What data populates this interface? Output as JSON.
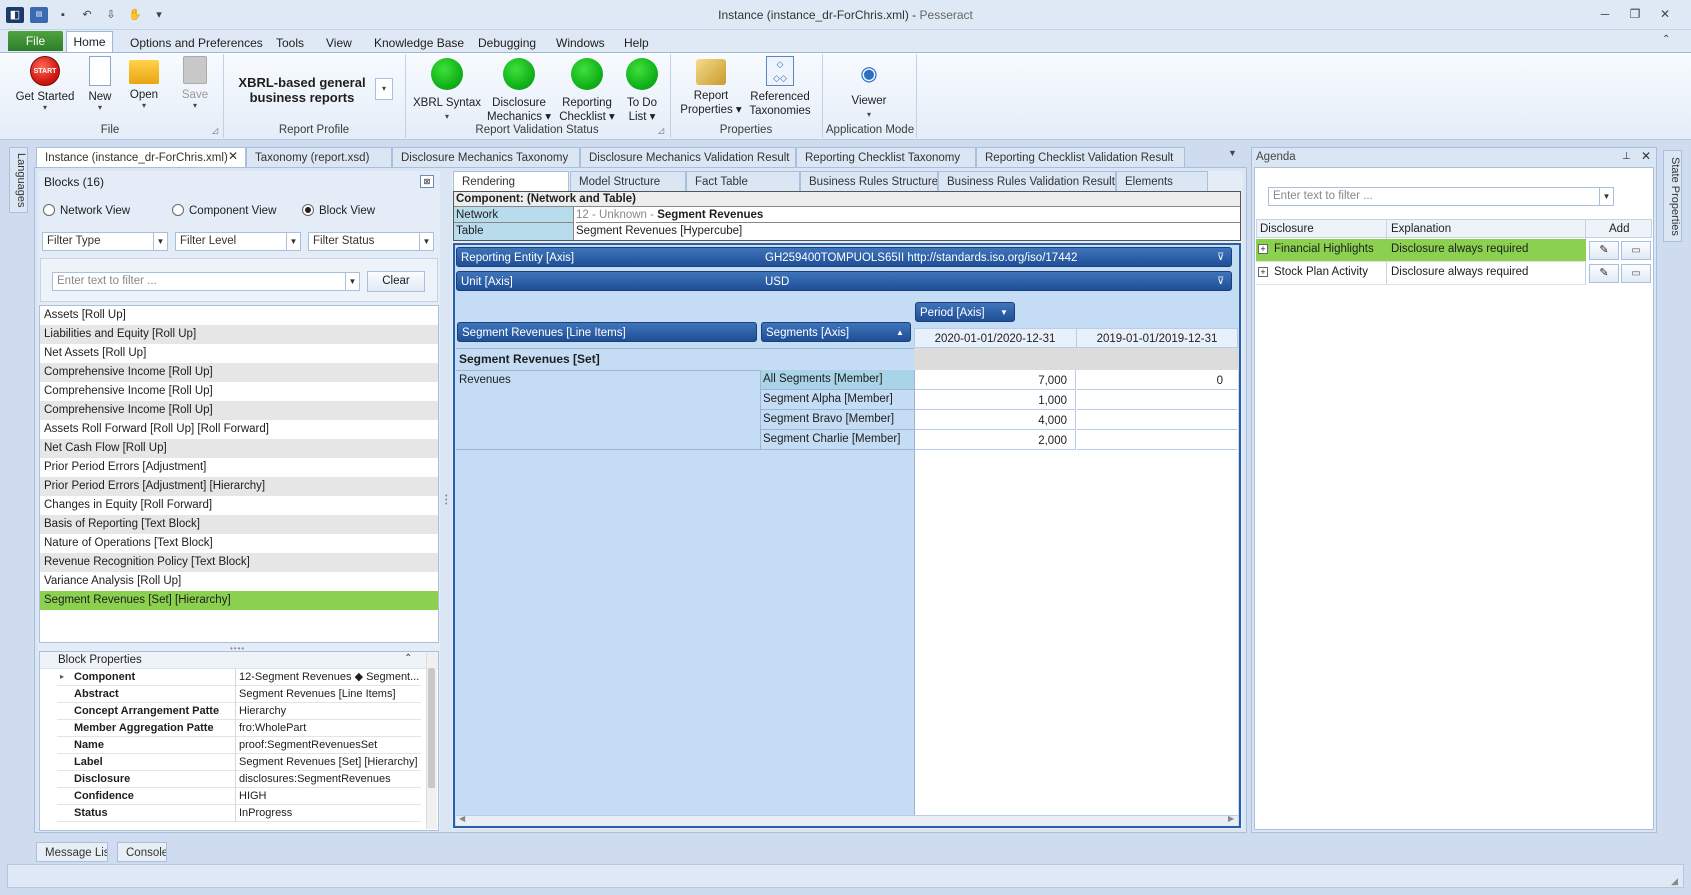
{
  "window": {
    "title": "Instance (instance_dr-ForChris.xml)",
    "app_name": "Pesseract",
    "controls": [
      "minimize",
      "restore",
      "close"
    ]
  },
  "menu": {
    "file": "File",
    "tabs": [
      "Home",
      "Options and Preferences",
      "Tools",
      "View",
      "Knowledge Base",
      "Debugging",
      "Windows",
      "Help"
    ]
  },
  "ribbon": {
    "file_group": {
      "label": "File",
      "buttons": [
        "Get Started",
        "New",
        "Open",
        "Save"
      ],
      "start_text": "START"
    },
    "report_profile": {
      "label": "Report Profile",
      "line1": "XBRL-based general",
      "line2": "business reports"
    },
    "validation": {
      "label": "Report Validation Status",
      "buttons": [
        {
          "l1": "XBRL Syntax",
          "l2": ""
        },
        {
          "l1": "Disclosure",
          "l2": "Mechanics"
        },
        {
          "l1": "Reporting",
          "l2": "Checklist"
        },
        {
          "l1": "To Do",
          "l2": "List"
        }
      ]
    },
    "properties": {
      "label": "Properties",
      "buttons": [
        {
          "l1": "Report",
          "l2": "Properties"
        },
        {
          "l1": "Referenced",
          "l2": "Taxonomies"
        }
      ]
    },
    "mode": {
      "label": "Application Mode",
      "button": "Viewer"
    }
  },
  "left_sidebar": {
    "label": "Languages"
  },
  "right_sidebar": {
    "label": "State Properties"
  },
  "doc_tabs": [
    "Instance (instance_dr-ForChris.xml)",
    "Taxonomy (report.xsd)",
    "Disclosure Mechanics Taxonomy",
    "Disclosure Mechanics Validation Result",
    "Reporting Checklist Taxonomy",
    "Reporting Checklist Validation Result"
  ],
  "blocks": {
    "header": "Blocks (16)",
    "views": [
      "Network View",
      "Component View",
      "Block View"
    ],
    "filters": [
      "Filter Type",
      "Filter Level",
      "Filter Status"
    ],
    "filter_placeholder": "Enter text to filter ...",
    "clear": "Clear",
    "items": [
      "Assets [Roll Up]",
      "Liabilities and Equity [Roll Up]",
      "Net Assets [Roll Up]",
      "Comprehensive Income [Roll Up]",
      "Comprehensive Income [Roll Up]",
      "Comprehensive Income [Roll Up]",
      "Assets Roll Forward [Roll Up] [Roll Forward]",
      "Net Cash Flow [Roll Up]",
      "Prior Period Errors [Adjustment]",
      "Prior Period Errors [Adjustment] [Hierarchy]",
      "Changes in Equity [Roll Forward]",
      "Basis of Reporting [Text Block]",
      "Nature of Operations [Text Block]",
      "Revenue Recognition Policy [Text Block]",
      "Variance Analysis  [Roll Up]",
      "Segment Revenues [Set] [Hierarchy]"
    ]
  },
  "block_properties": {
    "header": "Block Properties",
    "rows": [
      {
        "k": "Component",
        "v": "12-Segment Revenues ◆ Segment..."
      },
      {
        "k": "Abstract",
        "v": "Segment Revenues [Line Items]"
      },
      {
        "k": "Concept Arrangement Patte",
        "v": "Hierarchy"
      },
      {
        "k": "Member Aggregation Patte",
        "v": "fro:WholePart"
      },
      {
        "k": "Name",
        "v": "proof:SegmentRevenuesSet"
      },
      {
        "k": "Label",
        "v": "Segment Revenues [Set] [Hierarchy]"
      },
      {
        "k": "Disclosure",
        "v": "disclosures:SegmentRevenues"
      },
      {
        "k": "Confidence",
        "v": "HIGH"
      },
      {
        "k": "Status",
        "v": "InProgress"
      }
    ]
  },
  "view_tabs": [
    "Rendering",
    "Model Structure",
    "Fact Table",
    "Business Rules Structure",
    "Business Rules Validation Results",
    "Elements"
  ],
  "component": {
    "header": "Component: (Network and Table)",
    "network_label": "Network",
    "network_prefix": "12 - Unknown - ",
    "network_value": "Segment Revenues",
    "table_label": "Table",
    "table_value": "Segment Revenues [Hypercube]"
  },
  "rendering": {
    "entity_axis": "Reporting Entity [Axis]",
    "entity_value": "GH259400TOMPUOLS65II http://standards.iso.org/iso/17442",
    "unit_axis": "Unit [Axis]",
    "unit_value": "USD",
    "period_axis": "Period [Axis]",
    "line_items": "Segment Revenues [Line Items]",
    "segments_axis": "Segments [Axis]",
    "periods": [
      "2020-01-01/2020-12-31",
      "2019-01-01/2019-12-31"
    ],
    "set_label": "Segment Revenues [Set]",
    "concept": "Revenues",
    "members": [
      {
        "name": "All Segments [Member]",
        "v1": "7,000",
        "v2": "0"
      },
      {
        "name": "Segment Alpha [Member]",
        "v1": "1,000",
        "v2": ""
      },
      {
        "name": "Segment Bravo [Member]",
        "v1": "4,000",
        "v2": ""
      },
      {
        "name": "Segment Charlie [Member]",
        "v1": "2,000",
        "v2": ""
      }
    ]
  },
  "agenda": {
    "title": "Agenda",
    "filter_placeholder": "Enter text to filter ...",
    "columns": [
      "Disclosure",
      "Explanation",
      "Add"
    ],
    "rows": [
      {
        "disclosure": "Financial Highlights",
        "explanation": "Disclosure always required"
      },
      {
        "disclosure": "Stock Plan Activity",
        "explanation": "Disclosure always required"
      }
    ]
  },
  "bottom_tabs": [
    "Message List",
    "Console"
  ],
  "colors": {
    "accent_green": "#8bd14f",
    "axis_blue": "#2a5ea8",
    "status_green": "#19c21f"
  }
}
